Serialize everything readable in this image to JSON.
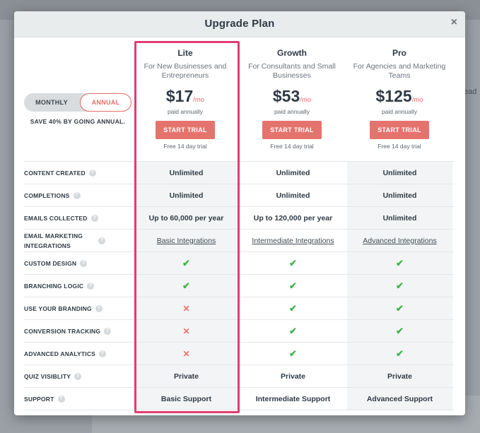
{
  "background": {
    "partial_text": "ead"
  },
  "modal": {
    "title": "Upgrade Plan",
    "close": "×"
  },
  "billing": {
    "monthly": "MONTHLY",
    "annual": "ANNUAL",
    "save_note": "SAVE 40% BY GOING ANNUAL."
  },
  "plans": [
    {
      "name": "Lite",
      "desc": "For New Businesses and Entrepreneurs",
      "price": "$17",
      "per": "/mo",
      "billing": "paid annually",
      "cta": "START TRIAL",
      "trial": "Free 14 day trial"
    },
    {
      "name": "Growth",
      "desc": "For Consultants and Small Businesses",
      "price": "$53",
      "per": "/mo",
      "billing": "paid annually",
      "cta": "START TRIAL",
      "trial": "Free 14 day trial"
    },
    {
      "name": "Pro",
      "desc": "For Agencies and Marketing Teams",
      "price": "$125",
      "per": "/mo",
      "billing": "paid annually",
      "cta": "START TRIAL",
      "trial": "Free 14 day trial"
    }
  ],
  "features": [
    {
      "label": "CONTENT CREATED",
      "values": [
        "Unlimited",
        "Unlimited",
        "Unlimited"
      ]
    },
    {
      "label": "COMPLETIONS",
      "values": [
        "Unlimited",
        "Unlimited",
        "Unlimited"
      ]
    },
    {
      "label": "EMAILS COLLECTED",
      "values": [
        "Up to 60,000 per year",
        "Up to 120,000 per year",
        "Unlimited"
      ]
    },
    {
      "label": "EMAIL MARKETING INTEGRATIONS",
      "values": [
        "Basic Integrations",
        "Intermediate Integrations",
        "Advanced Integrations"
      ]
    },
    {
      "label": "CUSTOM DESIGN",
      "values": [
        "✔",
        "✔",
        "✔"
      ]
    },
    {
      "label": "BRANCHING LOGIC",
      "values": [
        "✔",
        "✔",
        "✔"
      ]
    },
    {
      "label": "USE YOUR BRANDING",
      "values": [
        "✕",
        "✔",
        "✔"
      ]
    },
    {
      "label": "CONVERSION TRACKING",
      "values": [
        "✕",
        "✔",
        "✔"
      ]
    },
    {
      "label": "ADVANCED ANALYTICS",
      "values": [
        "✕",
        "✔",
        "✔"
      ]
    },
    {
      "label": "QUIZ VISIBLITY",
      "values": [
        "Private",
        "Private",
        "Private"
      ]
    },
    {
      "label": "SUPPORT",
      "values": [
        "Basic Support",
        "Intermediate Support",
        "Advanced Support"
      ]
    }
  ],
  "help_icon": "?",
  "icons": {
    "close": "close-icon",
    "help": "help-icon",
    "check": "check-icon",
    "cross": "cross-icon"
  },
  "colors": {
    "accent": "#e5736d",
    "highlight": "#e13d73",
    "check": "#3fb549",
    "cross": "#e7716b"
  }
}
